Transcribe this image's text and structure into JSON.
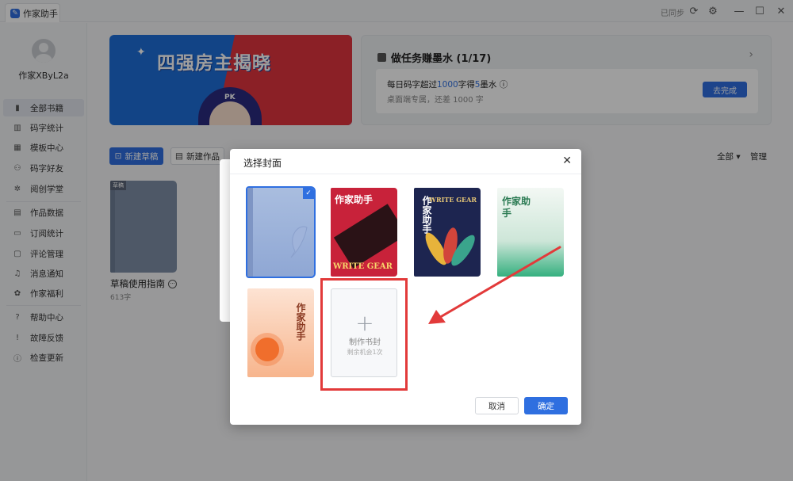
{
  "window": {
    "tab_title": "作家助手",
    "sync_status": "已同步",
    "icons": [
      "refresh-icon",
      "settings-icon",
      "minimize-icon",
      "maximize-icon",
      "close-icon"
    ]
  },
  "sidebar": {
    "username": "作家XByL2a",
    "items": [
      {
        "label": "全部书籍",
        "icon": "book-icon",
        "active": true
      },
      {
        "label": "码字统计",
        "icon": "stats-icon"
      },
      {
        "label": "模板中心",
        "icon": "grid-icon"
      },
      {
        "label": "码字好友",
        "icon": "friends-icon"
      },
      {
        "label": "阅创学堂",
        "icon": "academy-icon"
      },
      {
        "label": "作品数据",
        "icon": "chart-icon"
      },
      {
        "label": "订阅统计",
        "icon": "monitor-icon"
      },
      {
        "label": "评论管理",
        "icon": "comment-icon"
      },
      {
        "label": "消息通知",
        "icon": "bell-icon"
      },
      {
        "label": "作家福利",
        "icon": "gift-icon"
      },
      {
        "label": "帮助中心",
        "icon": "help-icon"
      },
      {
        "label": "故障反馈",
        "icon": "feedback-icon"
      },
      {
        "label": "检查更新",
        "icon": "update-icon"
      }
    ]
  },
  "banner": {
    "title": "四强房主揭晓",
    "badge": "PK"
  },
  "task": {
    "title": "做任务赚墨水 (1/17)",
    "line_prefix": "每日码字超过",
    "line_num1": "1000",
    "line_mid": "字得",
    "line_num2": "5",
    "line_suffix": "墨水",
    "sub": "桌面端专属，还差 1000 字",
    "button": "去完成"
  },
  "shelf": {
    "new_draft": "新建草稿",
    "new_work": "新建作品",
    "filter": "全部 ▾",
    "manage": "管理",
    "draft": {
      "tag": "草稿",
      "title": "草稿使用指南",
      "count": "613字"
    }
  },
  "modal": {
    "title": "选择封面",
    "covers": [
      {
        "style": "blue-plain",
        "selected": true
      },
      {
        "style": "red-gold",
        "title": "作家助手",
        "en": "WRITE GEAR"
      },
      {
        "style": "navy-leaves",
        "title": "作家助手",
        "en": "WRITE GEAR"
      },
      {
        "style": "green-mist",
        "title": "作家助手"
      },
      {
        "style": "orange-flower",
        "title": "作家助手"
      }
    ],
    "make_cover": {
      "label": "制作书封",
      "sub": "剩余机会1次"
    },
    "cancel": "取消",
    "confirm": "确定"
  },
  "colors": {
    "accent": "#2f6fe0",
    "highlight": "#e23a3a"
  }
}
